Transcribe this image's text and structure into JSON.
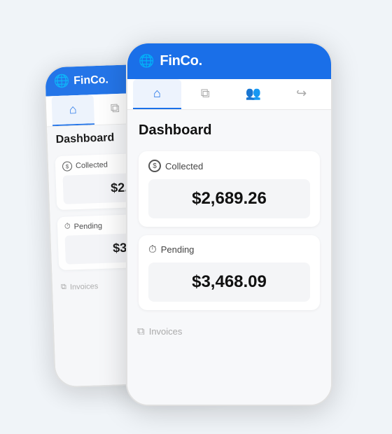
{
  "app": {
    "brand_icon": "🌐",
    "brand_name": "FinCo.",
    "page_title": "Dashboard",
    "nav_tabs": [
      {
        "label": "home",
        "icon": "⌂",
        "active": true
      },
      {
        "label": "documents",
        "icon": "⧉",
        "active": false
      },
      {
        "label": "team",
        "icon": "👥",
        "active": false
      },
      {
        "label": "logout",
        "icon": "↪",
        "active": false
      }
    ],
    "cards": [
      {
        "id": "collected",
        "label": "Collected",
        "label_icon": "$",
        "amount": "$2,689.26"
      },
      {
        "id": "pending",
        "label": "Pending",
        "label_icon": "⏱",
        "amount": "$3,468.09"
      }
    ],
    "invoices_label": "Invoices",
    "colors": {
      "primary": "#1a6fe8",
      "bg": "#f7f8fa",
      "card_bg": "#fff",
      "amount_bg": "#f4f5f7"
    }
  }
}
